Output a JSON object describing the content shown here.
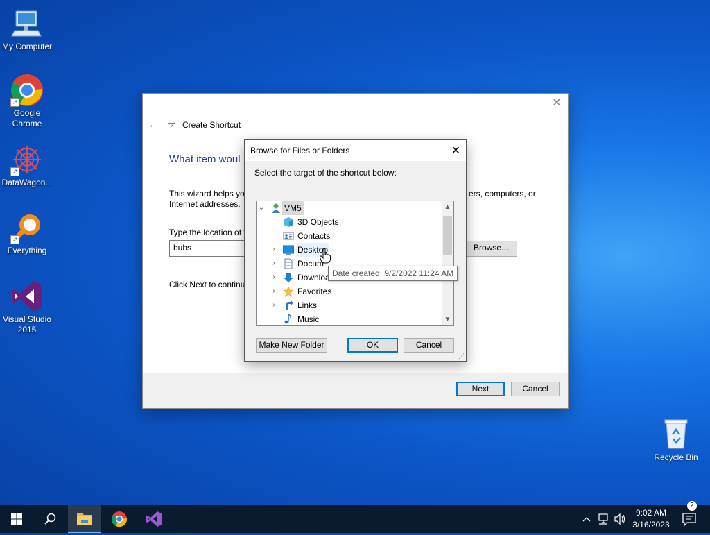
{
  "desktop": {
    "icons": [
      {
        "label": "My Computer"
      },
      {
        "label": "Google Chrome"
      },
      {
        "label": "DataWagon..."
      },
      {
        "label": "Everything"
      },
      {
        "label": "Visual Studio 2015"
      },
      {
        "label": "Recycle Bin"
      }
    ]
  },
  "wizard": {
    "title": "Create Shortcut",
    "heading": "What item woul",
    "description": "This wizard helps you",
    "description_right": "ers, computers, or",
    "description_line2": "Internet addresses.",
    "location_label": "Type the location of t",
    "location_value": "buhs",
    "browse_label": "Browse...",
    "click_next_text": "Click Next to continu",
    "next_label": "Next",
    "cancel_label": "Cancel"
  },
  "browse_dialog": {
    "title": "Browse for Files or Folders",
    "prompt": "Select the target of the shortcut below:",
    "tree": [
      {
        "label": "VM5",
        "icon": "user-folder-icon",
        "expanded": true
      },
      {
        "label": "3D Objects",
        "icon": "cube-icon"
      },
      {
        "label": "Contacts",
        "icon": "contacts-icon"
      },
      {
        "label": "Desktop",
        "icon": "desktop-icon",
        "expandable": true
      },
      {
        "label": "Docum",
        "icon": "documents-icon",
        "expandable": true
      },
      {
        "label": "Downloa",
        "icon": "downloads-icon",
        "expandable": true
      },
      {
        "label": "Favorites",
        "icon": "star-icon",
        "expandable": true
      },
      {
        "label": "Links",
        "icon": "links-icon",
        "expandable": true
      },
      {
        "label": "Music",
        "icon": "music-icon"
      }
    ],
    "tooltip": "Date created: 9/2/2022 11:24 AM",
    "new_folder_label": "Make New Folder",
    "ok_label": "OK",
    "cancel_label": "Cancel"
  },
  "taskbar": {
    "time": "9:02 AM",
    "date": "3/16/2023",
    "notification_count": "2"
  }
}
